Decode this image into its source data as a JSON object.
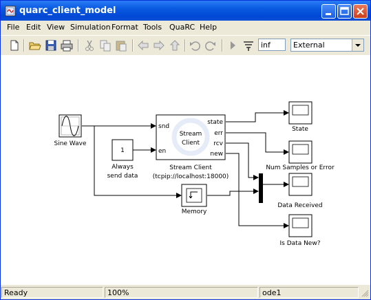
{
  "window": {
    "title": "quarc_client_model"
  },
  "menu": [
    "File",
    "Edit",
    "View",
    "Simulation",
    "Format",
    "Tools",
    "QuaRC",
    "Help"
  ],
  "toolbar": {
    "stop_time": "inf",
    "sim_mode": "External"
  },
  "diagram": {
    "sine_wave": "Sine Wave",
    "constant_value": "1",
    "constant_label_1": "Always",
    "constant_label_2": "send data",
    "stream_client_inner_1": "Stream",
    "stream_client_inner_2": "Client",
    "stream_client_name": "Stream Client",
    "stream_client_uri": "(tcpip://localhost:18000)",
    "port_snd": "snd",
    "port_en": "en",
    "port_state": "state",
    "port_err": "err",
    "port_rcv": "rcv",
    "port_new": "new",
    "memory": "Memory",
    "scope_state": "State",
    "scope_num_samples": "Num Samples or Error",
    "scope_data_received": "Data Received",
    "scope_is_new": "Is Data New?"
  },
  "status": {
    "ready": "Ready",
    "zoom": "100%",
    "solver": "ode1"
  }
}
